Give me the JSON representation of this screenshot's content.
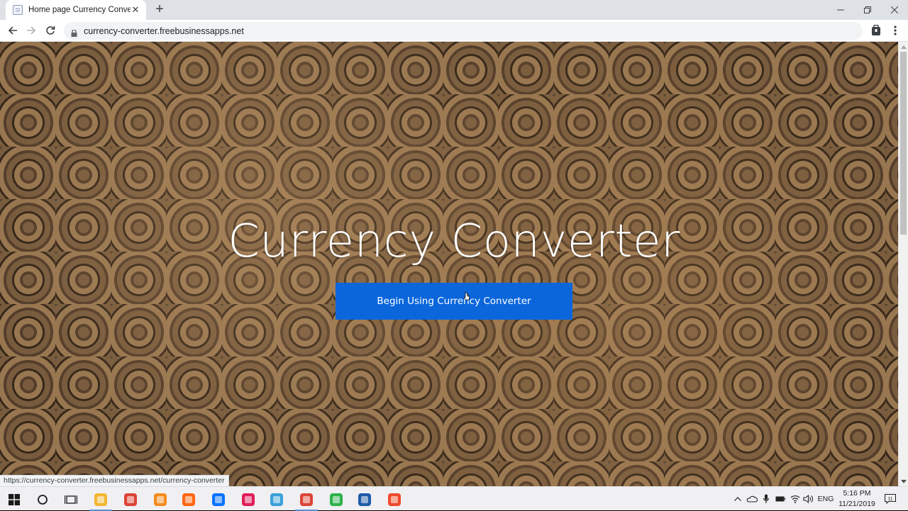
{
  "browser": {
    "tab_title": "Home page Currency Converter",
    "new_tab_label": "+",
    "url": "currency-converter.freebusinessapps.net",
    "status_url": "https://currency-converter.freebusinessapps.net/currency-converter"
  },
  "page": {
    "title": "Currency Converter",
    "cta_label": "Begin Using Currency Converter"
  },
  "taskbar": {
    "apps": [
      {
        "name": "file-explorer-icon",
        "color": "#f2b632"
      },
      {
        "name": "chrome-icon",
        "color": "#db4437"
      },
      {
        "name": "sublime-text-icon",
        "color": "#f48b1f"
      },
      {
        "name": "firefox-icon",
        "color": "#ff6611"
      },
      {
        "name": "zalo-icon",
        "color": "#0a74ff"
      },
      {
        "name": "slack-icon",
        "color": "#e01e5a"
      },
      {
        "name": "paint-icon",
        "color": "#3aa0d8"
      },
      {
        "name": "chrome-active-icon",
        "color": "#db4437"
      },
      {
        "name": "camtasia-icon",
        "color": "#2fb24c"
      },
      {
        "name": "visual-studio-icon",
        "color": "#1e5aa8"
      },
      {
        "name": "camtasia-recorder-icon",
        "color": "#ef4a2c"
      }
    ],
    "language": "ENG",
    "time": "5:16 PM",
    "date": "11/21/2019",
    "notification_count": "11"
  },
  "colors": {
    "accent": "#0b66dc"
  }
}
